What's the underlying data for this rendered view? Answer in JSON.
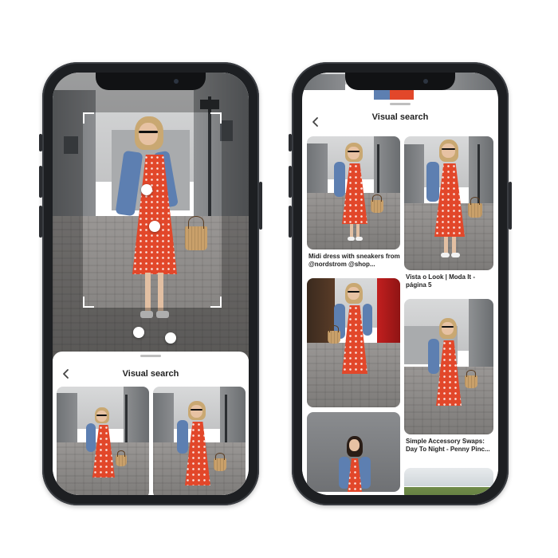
{
  "left_phone": {
    "sheet_title": "Visual search",
    "icons": {
      "back": "chevron-left-icon"
    }
  },
  "right_phone": {
    "sheet_title": "Visual search",
    "icons": {
      "back": "chevron-left-icon"
    },
    "pins": [
      {
        "caption": "Midi dress with sneakers from @nordstrom @shop..."
      },
      {
        "caption": "Vista o Look | Moda It - página 5"
      },
      {
        "caption": ""
      },
      {
        "caption": "Simple Accessory Swaps: Day To Night - Penny Pinc..."
      },
      {
        "caption": ""
      },
      {
        "caption": ""
      }
    ]
  },
  "colors": {
    "phone_body": "#1d1f22",
    "dress_red": "#e2472a",
    "denim": "#5d7fb1"
  }
}
